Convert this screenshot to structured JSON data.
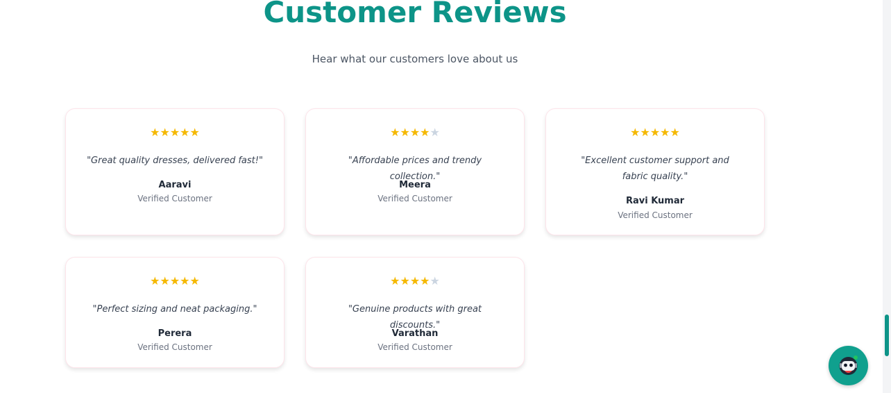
{
  "section": {
    "title": "Customer Reviews",
    "subtitle": "Hear what our customers love about us"
  },
  "reviews": [
    {
      "rating": 5,
      "max_rating": 5,
      "stars_filled": "★★★★★",
      "stars_empty": "",
      "quote": "\"Great quality dresses, delivered fast!\"",
      "name": "Aaravi",
      "role": "Verified Customer"
    },
    {
      "rating": 4,
      "max_rating": 5,
      "stars_filled": "★★★★",
      "stars_empty": "★",
      "quote": "\"Affordable prices and trendy collection.\"",
      "name": "Meera",
      "role": "Verified Customer"
    },
    {
      "rating": 5,
      "max_rating": 5,
      "stars_filled": "★★★★★",
      "stars_empty": "",
      "quote": "\"Excellent customer support and fabric quality.\"",
      "name": "Ravi Kumar",
      "role": "Verified Customer"
    },
    {
      "rating": 5,
      "max_rating": 5,
      "stars_filled": "★★★★★",
      "stars_empty": "",
      "quote": "\"Perfect sizing and neat packaging.\"",
      "name": "Perera",
      "role": "Verified Customer"
    },
    {
      "rating": 4,
      "max_rating": 5,
      "stars_filled": "★★★★",
      "stars_empty": "★",
      "quote": "\"Genuine products with great discounts.\"",
      "name": "Varathan",
      "role": "Verified Customer"
    }
  ],
  "chat_button": {
    "icon": "robot-chat-icon"
  },
  "colors": {
    "accent": "#0d9488",
    "star": "#f5b800",
    "star_empty": "#cbd5e1",
    "fab": "#10a08e"
  }
}
